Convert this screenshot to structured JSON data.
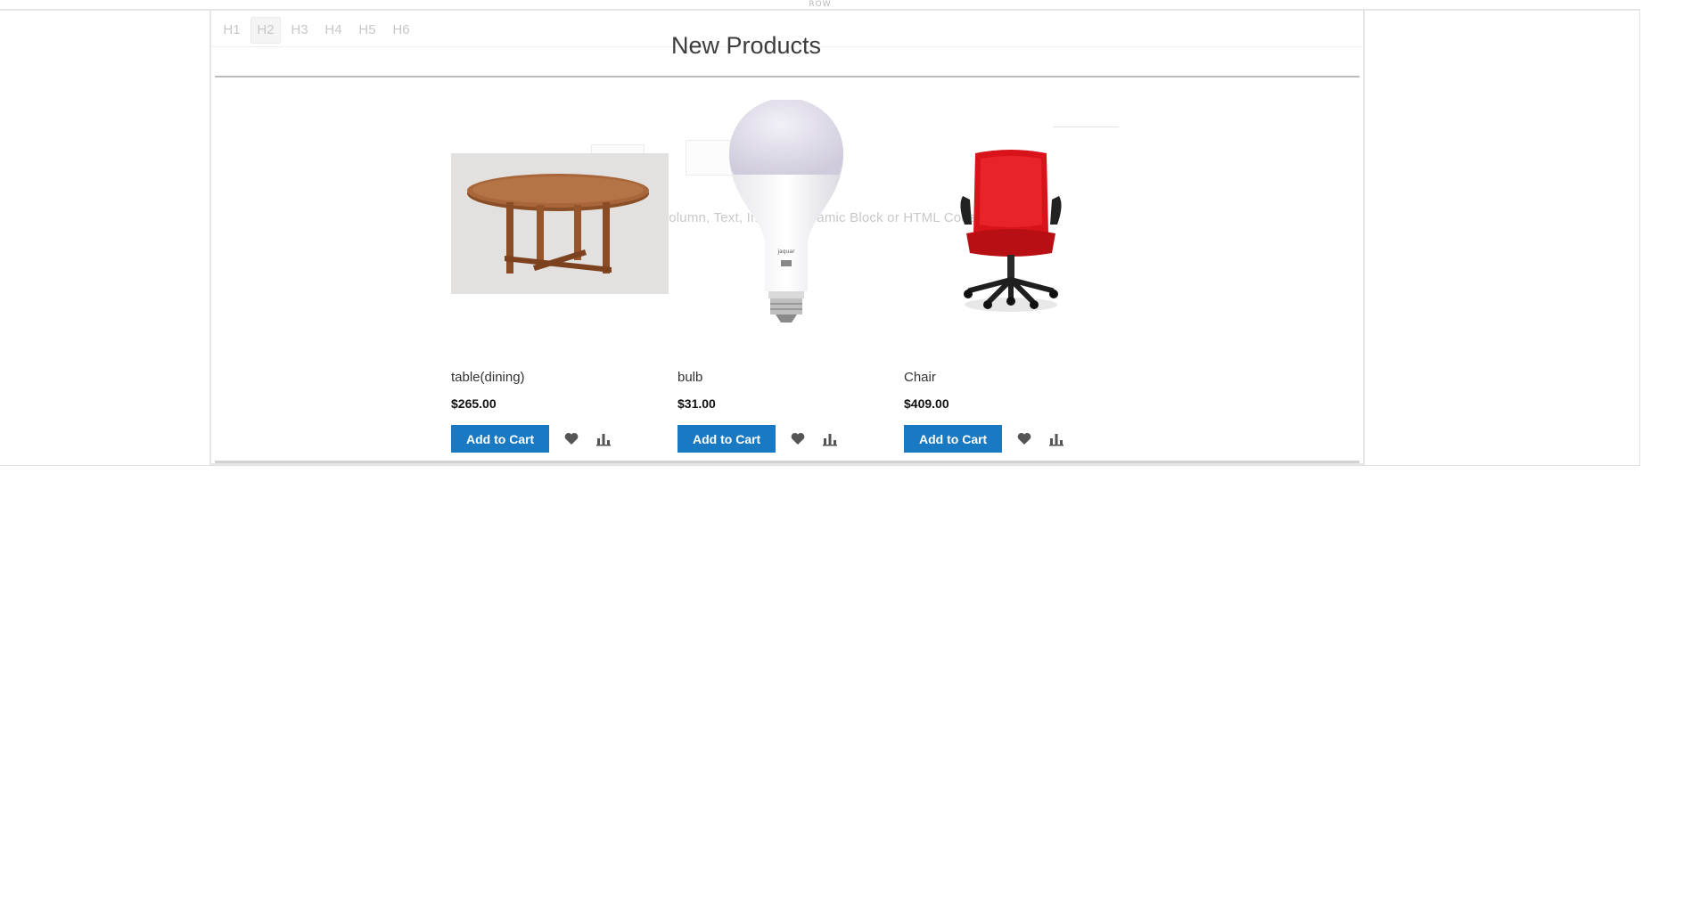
{
  "row_label": "ROW",
  "heading_toolbar": [
    "H1",
    "H2",
    "H3",
    "H4",
    "H5",
    "H6"
  ],
  "heading_toolbar_active": "H2",
  "block_title": "New Products",
  "faint_help_text": "Drag Row, Column, Text, Image, Dynamic Block or HTML Code here",
  "products": [
    {
      "name": "table(dining)",
      "price": "$265.00",
      "add_to_cart": "Add to Cart",
      "image": "round-wooden-table"
    },
    {
      "name": "bulb",
      "price": "$31.00",
      "add_to_cart": "Add to Cart",
      "image": "led-bulb"
    },
    {
      "name": "Chair",
      "price": "$409.00",
      "add_to_cart": "Add to Cart",
      "image": "red-office-chair"
    }
  ],
  "icons": {
    "wishlist": "heart-icon",
    "compare": "compare-bars-icon"
  },
  "colors": {
    "primary_button": "#1979c3",
    "chair_red": "#d8141a",
    "table_wood": "#9a5a2e"
  }
}
